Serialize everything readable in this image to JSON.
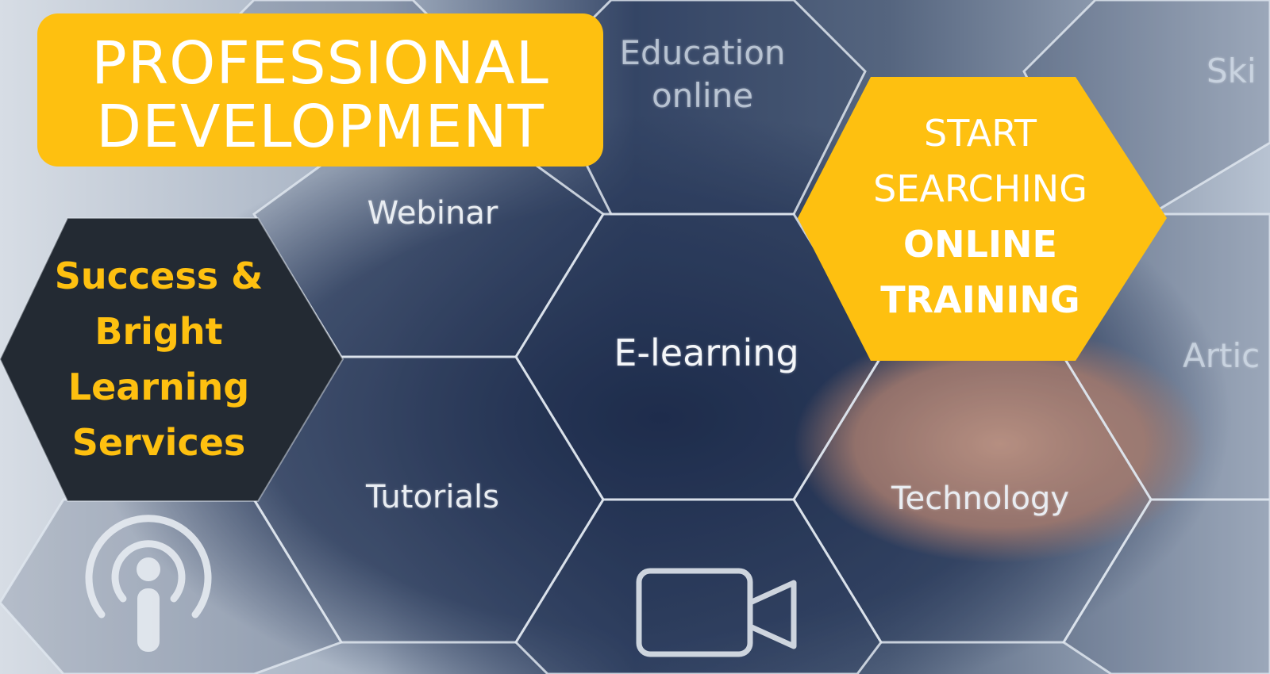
{
  "colors": {
    "accent_yellow": "#fec010",
    "dark_hex": "#232a33",
    "hex_stroke": "#dfe6ee",
    "title_text": "#ffffff"
  },
  "title": {
    "line1": "PROFESSIONAL",
    "line2": "DEVELOPMENT"
  },
  "brand_hex": {
    "line1": "Success &",
    "line2": "Bright",
    "line3": "Learning",
    "line4": "Services"
  },
  "cta": {
    "line1": "START",
    "line2": "SEARCHING",
    "line3": "ONLINE",
    "line4": "TRAINING"
  },
  "hex_labels": {
    "education_line1": "Education",
    "education_line2": "online",
    "webinar": "Webinar",
    "elearning": "E-learning",
    "tutorials": "Tutorials",
    "technology": "Technology",
    "skills_partial": "Ski",
    "articles_partial": "Artic"
  },
  "icons": {
    "podcast": "podcast-icon",
    "video": "video-camera-icon"
  }
}
